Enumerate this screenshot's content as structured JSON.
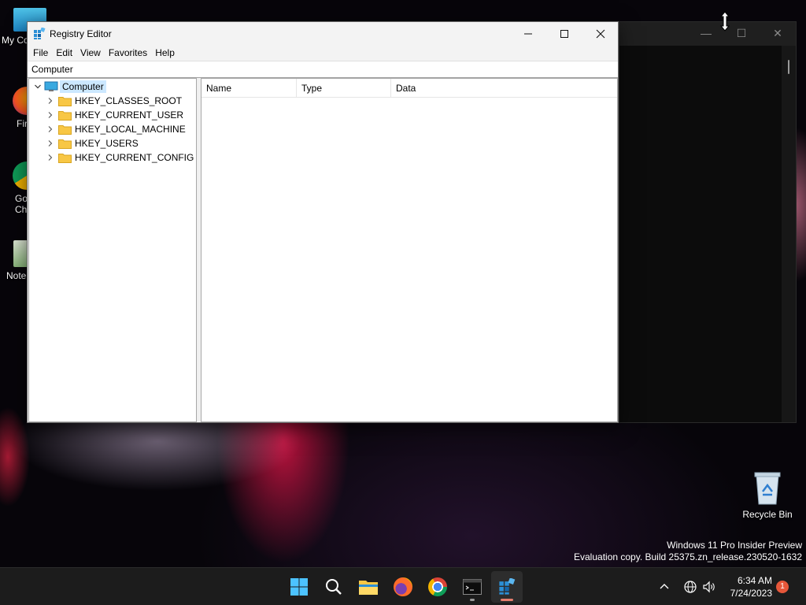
{
  "desktop": {
    "icons": [
      {
        "label": "My Co"
      },
      {
        "label": "Fir"
      },
      {
        "label": "Go\nCh"
      },
      {
        "label": "Note"
      }
    ],
    "recycle_bin_label": "Recycle Bin",
    "watermark_line1": "Windows 11 Pro Insider Preview",
    "watermark_line2": "Evaluation copy. Build 25375.zn_release.230520-1632"
  },
  "regedit": {
    "title": "Registry Editor",
    "menu": [
      "File",
      "Edit",
      "View",
      "Favorites",
      "Help"
    ],
    "address": "Computer",
    "tree": {
      "root": "Computer",
      "children": [
        "HKEY_CLASSES_ROOT",
        "HKEY_CURRENT_USER",
        "HKEY_LOCAL_MACHINE",
        "HKEY_USERS",
        "HKEY_CURRENT_CONFIG"
      ]
    },
    "columns": [
      "Name",
      "Type",
      "Data"
    ]
  },
  "taskbar": {
    "apps": [
      "start-icon",
      "search-icon",
      "file-explorer-icon",
      "firefox-icon",
      "chrome-icon",
      "terminal-icon",
      "registry-editor-icon"
    ],
    "time": "6:34 AM",
    "date": "7/24/2023",
    "notification_count": "1"
  },
  "colors": {
    "accent": "#0078d4",
    "selection": "#cce8ff",
    "folder": "#f8c745",
    "active_indicator": "#e67e6e"
  }
}
